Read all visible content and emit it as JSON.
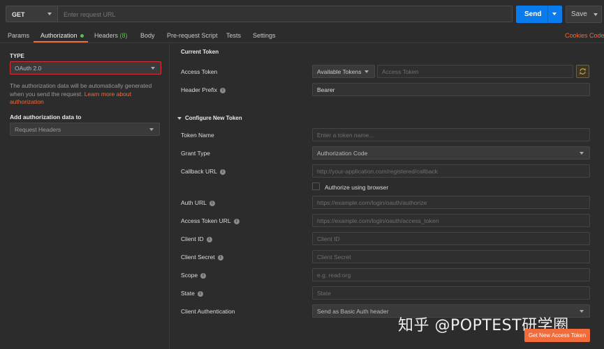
{
  "request": {
    "method": "GET",
    "url_placeholder": "Enter request URL",
    "send_label": "Send",
    "save_label": "Save"
  },
  "tabs": {
    "params": "Params",
    "authorization": "Authorization",
    "headers": "Headers",
    "headers_count": "(8)",
    "body": "Body",
    "prerequest": "Pre-request Script",
    "tests": "Tests",
    "settings": "Settings",
    "cookies": "Cookies",
    "code": "Code"
  },
  "left": {
    "type_label": "TYPE",
    "type_value": "OAuth 2.0",
    "desc_text": "The authorization data will be automatically generated when you send the request. ",
    "learn_more": "Learn more about authorization",
    "add_label": "Add authorization data to",
    "add_value": "Request Headers"
  },
  "current_token": {
    "title": "Current Token",
    "access_token_label": "Access Token",
    "available_tokens": "Available Tokens",
    "access_token_placeholder": "Access Token",
    "header_prefix_label": "Header Prefix",
    "header_prefix_value": "Bearer"
  },
  "configure": {
    "title": "Configure New Token",
    "token_name_label": "Token Name",
    "token_name_placeholder": "Enter a token name...",
    "grant_type_label": "Grant Type",
    "grant_type_value": "Authorization Code",
    "callback_label": "Callback URL",
    "callback_placeholder": "http://your-application.com/registered/callback",
    "authorize_browser": "Authorize using browser",
    "auth_url_label": "Auth URL",
    "auth_url_placeholder": "https://example.com/login/oauth/authorize",
    "access_token_url_label": "Access Token URL",
    "access_token_url_placeholder": "https://example.com/login/oauth/access_token",
    "client_id_label": "Client ID",
    "client_id_placeholder": "Client ID",
    "client_secret_label": "Client Secret",
    "client_secret_placeholder": "Client Secret",
    "scope_label": "Scope",
    "scope_placeholder": "e.g. read:org",
    "state_label": "State",
    "state_placeholder": "State",
    "client_auth_label": "Client Authentication",
    "client_auth_value": "Send as Basic Auth header",
    "get_token_button": "Get New Access Token"
  },
  "watermark": "知乎 @POPTEST研学圈",
  "colors": {
    "accent_orange": "#f26b3a",
    "send_blue": "#097bed",
    "status_green": "#4fc34f",
    "error_red": "#d63232"
  }
}
